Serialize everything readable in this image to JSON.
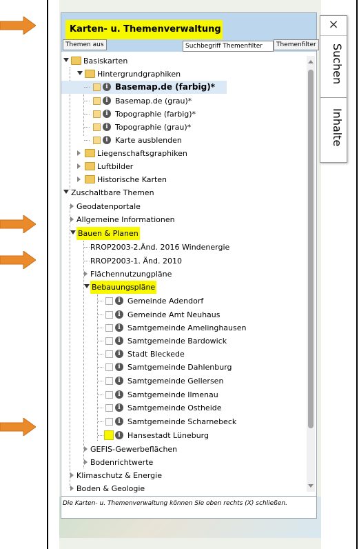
{
  "panel": {
    "title": "Karten- u. Themenverwaltung",
    "themes_off_button": "Themen aus",
    "filter_placeholder": "Suchbegriff Themenfilter",
    "filter_button": "Themenfilter",
    "footer": "Die Karten- u. Themenverwaltung können Sie oben rechts (X) schließen."
  },
  "side_tabs": {
    "close": "×",
    "search": "Suchen",
    "contents": "Inhalte"
  },
  "tree": {
    "basiskarten": "Basiskarten",
    "hintergrund": "Hintergrundgraphiken",
    "bg_items": [
      "Basemap.de (farbig)*",
      "Basemap.de (grau)*",
      "Topographie (farbig)*",
      "Topographie (grau)*",
      "Karte ausblenden"
    ],
    "liegenschaft": "Liegenschaftsgraphiken",
    "luftbilder": "Luftbilder",
    "historische": "Historische Karten",
    "zuschaltbar": "Zuschaltbare Themen",
    "geodatenportale": "Geodatenportale",
    "allgemeine": "Allgemeine Informationen",
    "bauen": "Bauen & Planen",
    "rrop1": "RROP2003-2.Änd. 2016 Windenergie",
    "rrop2": "RROP2003-1. Änd. 2010",
    "flaechen": "Flächennutzungpläne",
    "bebauung": "Bebauungspläne",
    "gemeinden": [
      "Gemeinde Adendorf",
      "Gemeinde Amt Neuhaus",
      "Samtgemeinde Amelinghausen",
      "Samtgemeinde Bardowick",
      "Stadt Bleckede",
      "Samtgemeinde Dahlenburg",
      "Samtgemeinde Gellersen",
      "Samtgemeinde Ilmenau",
      "Samtgemeinde Ostheide",
      "Samtgemeinde Scharnebeck",
      "Hansestadt Lüneburg"
    ],
    "gefis": "GEFIS-Gewerbeflächen",
    "boden_richt": "Bodenrichtwerte",
    "klima": "Klimaschutz & Energie",
    "boden_geo": "Boden & Geologie"
  },
  "colors": {
    "highlight": "#f7f700",
    "arrow": "#ea8a2b",
    "header": "#bcd6ee"
  }
}
